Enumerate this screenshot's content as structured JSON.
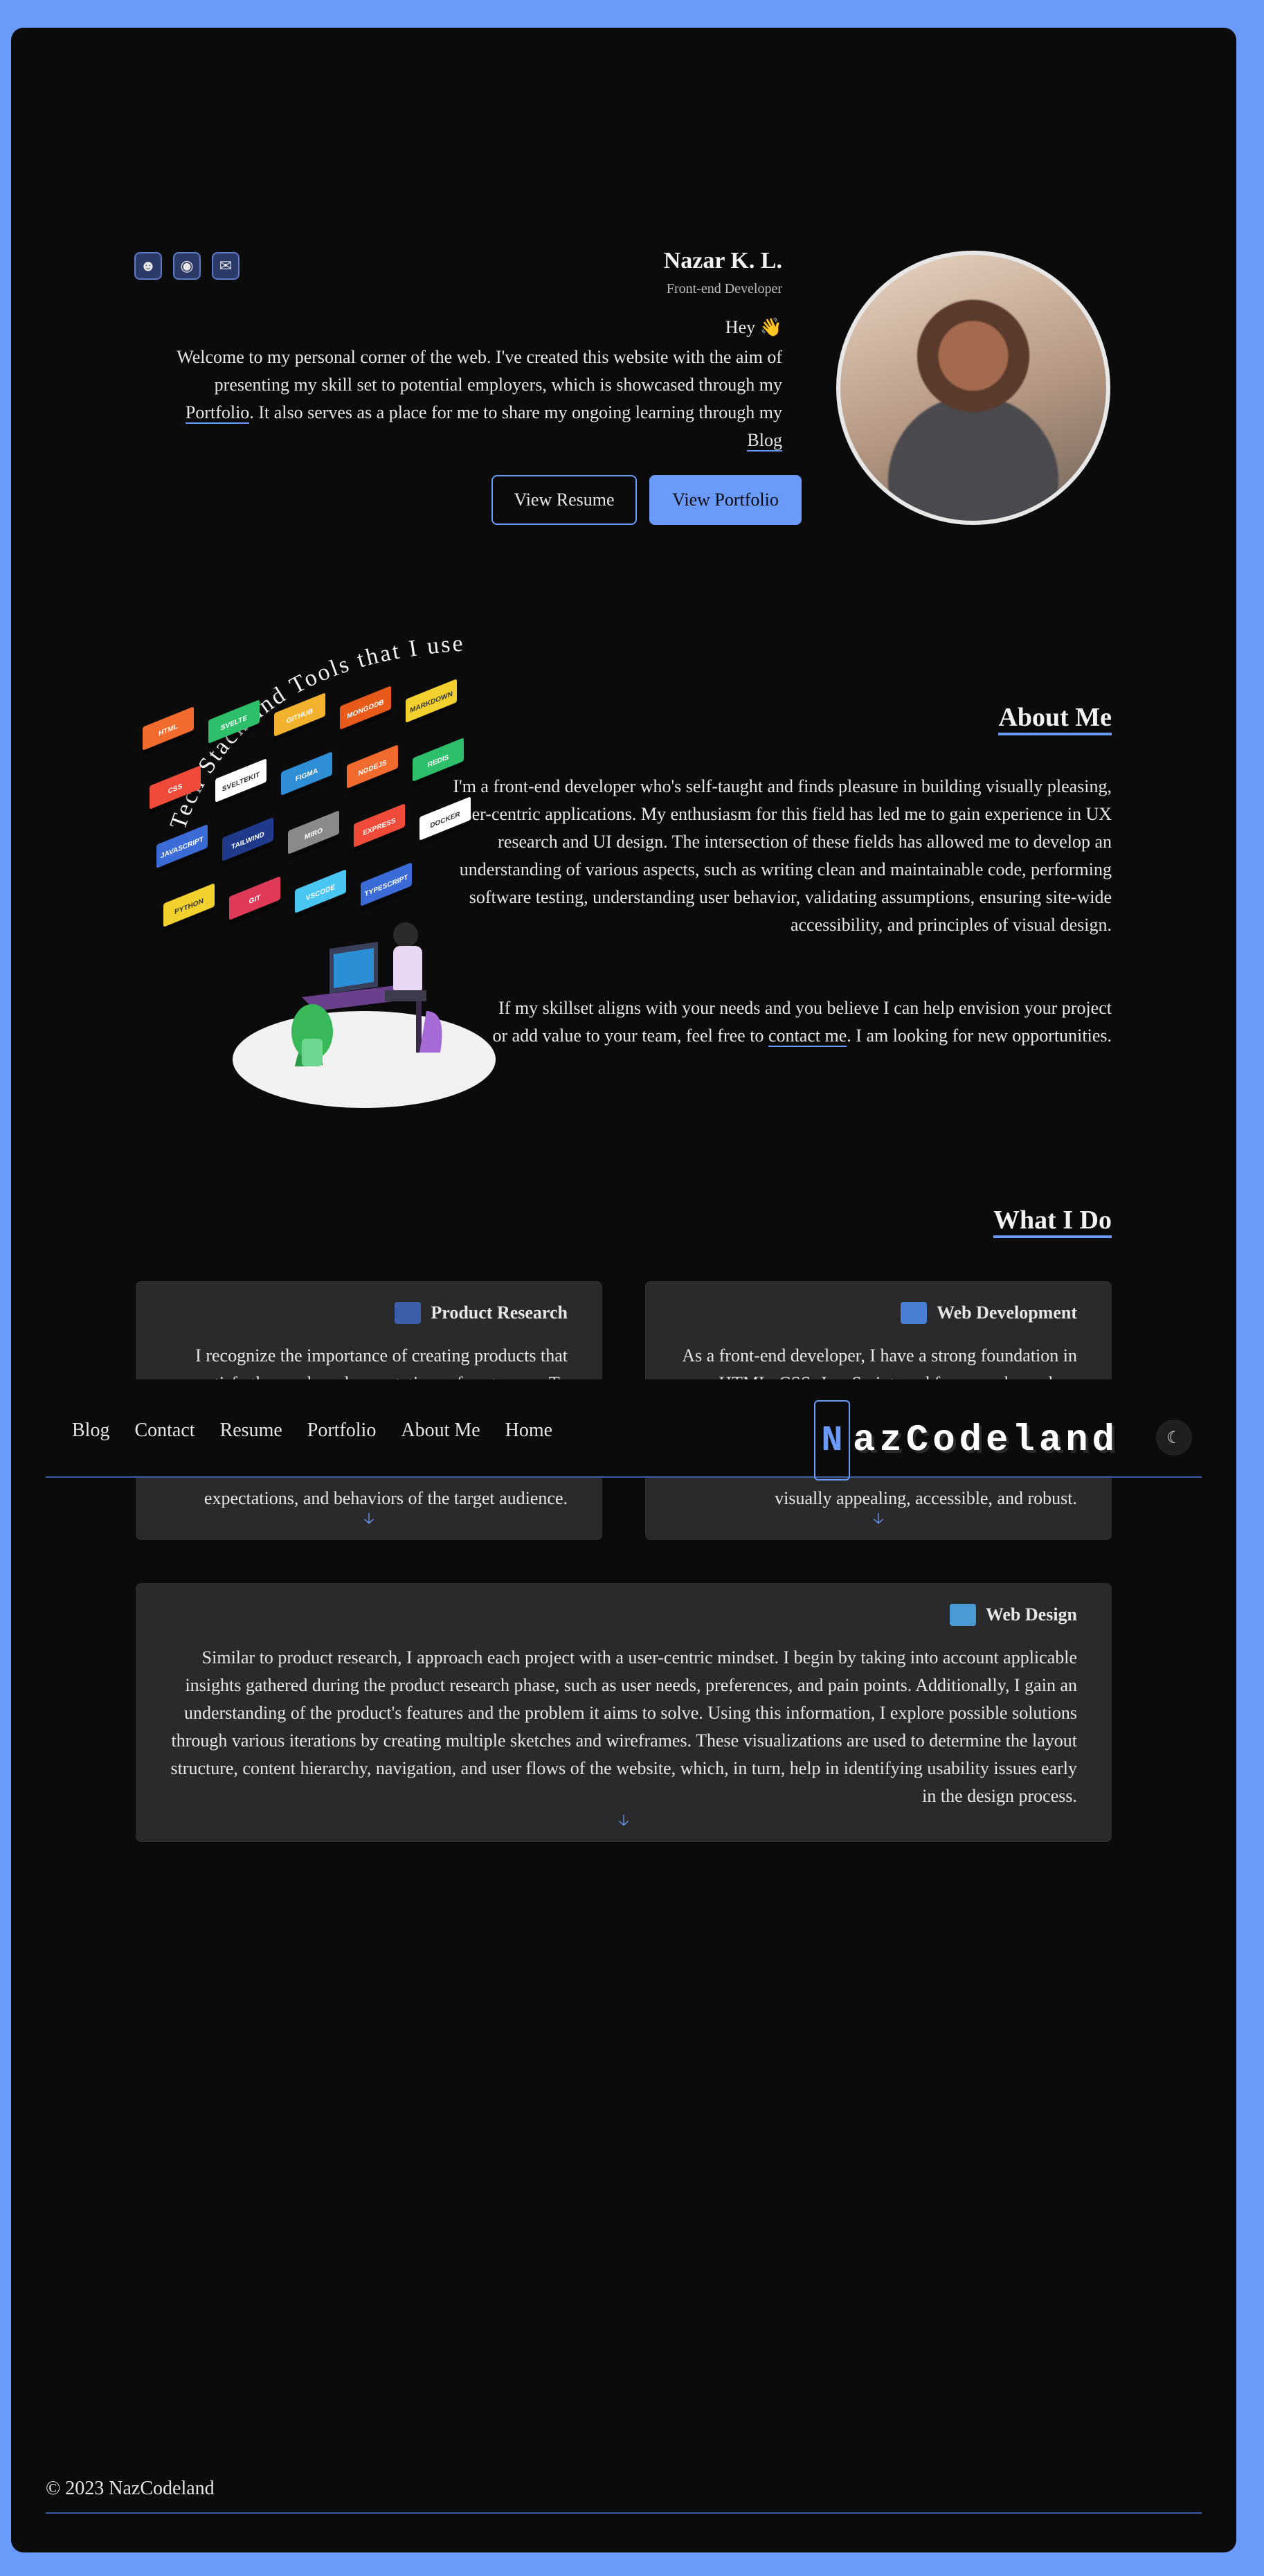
{
  "hero": {
    "name": "Nazar K. L.",
    "role": "Front-end Developer",
    "greeting": "Hey 👋",
    "intro": "Welcome to my personal corner of the web. I've created this website with the aim of presenting my skill set to potential employers, which is showcased through my ",
    "portfolio_link": "Portfolio",
    "intro2": ". It also serves as a place for me to share my ongoing learning through my ",
    "blog_link": "Blog",
    "btn_portfolio": "View Portfolio",
    "btn_resume": "View Resume"
  },
  "social": [
    "mail-icon",
    "discord-icon",
    "github-icon"
  ],
  "about": {
    "heading": "About Me",
    "p1": "I'm a front-end developer who's self-taught and finds pleasure in building visually pleasing, user-centric applications. My enthusiasm for this field has led me to gain experience in UX research and UI design. The intersection of these fields has allowed me to develop an understanding of various aspects, such as writing clean and maintainable code, performing software testing, understanding user behavior, validating assumptions, ensuring site-wide accessibility, and principles of visual design.",
    "p2_a": "If my skillset aligns with your needs and you believe I can help envision your project or add value to your team, feel free to ",
    "p2_link": "contact me",
    "p2_b": ". I am looking for new opportunities."
  },
  "tech": {
    "title": "Tech Stack and Tools that I use",
    "tags": [
      "HTML",
      "CSS",
      "JAVASCRIPT",
      "PYTHON",
      "SVELTE",
      "SVELTEKIT",
      "TAILWIND",
      "GIT",
      "GITHUB",
      "FIGMA",
      "MIRO",
      "VSCODE",
      "MONGODB",
      "NODEJS",
      "EXPRESS",
      "TYPESCRIPT",
      "MARKDOWN",
      "REDIS",
      "DOCKER"
    ]
  },
  "what_i_do": {
    "heading": "What I Do",
    "cards": [
      {
        "title": "Web Development",
        "body_top": "As a front-end developer, I have a strong foundation in HTML, CSS, JavaScript, and frameworks such as",
        "body_bottom": "visually appealing, accessible, and robust.",
        "icon": "monitor-icon",
        "icon_color": "#4a7fd6"
      },
      {
        "title": "Product Research",
        "body_top": "I recognize the importance of creating products that satisfy the needs and expectations of customers. To",
        "body_bottom": "expectations, and behaviors of the target audience.",
        "icon": "magnifier-icon",
        "icon_color": "#3a5ea8"
      },
      {
        "title": "Web Design",
        "body": "Similar to product research, I approach each project with a user-centric mindset. I begin by taking into account applicable insights gathered during the product research phase, such as user needs, preferences, and pain points. Additionally, I gain an understanding of the product's features and the problem it aims to solve. Using this information, I explore possible solutions through various iterations by creating multiple sketches and wireframes. These visualizations are used to determine the layout structure, content hierarchy, navigation, and user flows of the website, which, in turn, help in identifying usability issues early in the design process.",
        "icon": "design-icon",
        "icon_color": "#4a9ad6"
      }
    ]
  },
  "nav": {
    "brand_initial": "N",
    "brand_text": "azCodeland",
    "links": [
      "Home",
      "About Me",
      "Portfolio",
      "Resume",
      "Contact",
      "Blog"
    ]
  },
  "footer": {
    "text": "© 2023 NazCodeland"
  },
  "colors": {
    "accent": "#6b9bfa",
    "bg": "#0b0b0c",
    "card": "#2a2a2c",
    "frame": "#6b9bfa"
  }
}
